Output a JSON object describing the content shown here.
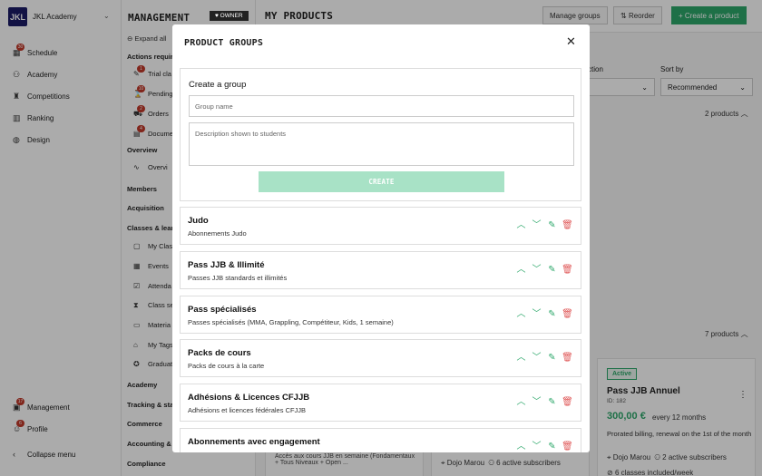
{
  "app": {
    "name": "JKL Academy",
    "logo_text": "JKL"
  },
  "rail": {
    "items": [
      {
        "label": "Schedule",
        "icon": "calendar-icon",
        "badge": "30"
      },
      {
        "label": "Academy",
        "icon": "people-icon"
      },
      {
        "label": "Competitions",
        "icon": "trophy-icon"
      },
      {
        "label": "Ranking",
        "icon": "ranking-icon"
      },
      {
        "label": "Design",
        "icon": "palette-icon"
      }
    ],
    "bottom": [
      {
        "label": "Management",
        "icon": "briefcase-icon",
        "badge": "17"
      },
      {
        "label": "Profile",
        "icon": "person-icon",
        "badge": "6"
      },
      {
        "label": "Collapse menu",
        "icon": "chevron-left-icon"
      }
    ]
  },
  "sub": {
    "title": "MANAGEMENT",
    "expand_all": "Expand all",
    "actions_header": "Actions requir",
    "actions": [
      {
        "label": "Trial cla",
        "badge": "1"
      },
      {
        "label": "Pending",
        "badge": "10"
      },
      {
        "label": "Orders",
        "badge": "2"
      },
      {
        "label": "Docume",
        "badge": "4"
      }
    ],
    "overview_header": "Overview",
    "overview_item": "Overvi",
    "members": "Members",
    "acquisition": "Acquisition",
    "classes_header": "Classes & learn",
    "classes": [
      "My Clas",
      "Events",
      "Attenda",
      "Class se",
      "Materia",
      "My Tags",
      "Graduat"
    ],
    "more": [
      "Academy",
      "Tracking & sta",
      "Commerce",
      "Accounting & i",
      "Compliance"
    ]
  },
  "main": {
    "owner_badge": "OWNER",
    "title": "MY PRODUCTS",
    "buttons": {
      "manage": "Manage groups",
      "reorder": "Reorder",
      "create": "Create a product"
    },
    "filters": {
      "section_label": "ction",
      "sort_label": "Sort by",
      "sort_value": "Recommended"
    },
    "counts": [
      "2 products",
      "7 products"
    ],
    "card": {
      "badge": "Active",
      "name": "Pass JJB Annuel",
      "id": "ID: 182",
      "price": "300,00 €",
      "period": "every 12 months",
      "billing": "Prorated billing, renewal on the 1st of the month",
      "location": "Dojo Marou",
      "subscribers": "2 active subscribers",
      "classes": "6 classes included/week"
    },
    "card2": {
      "location": "Dojo Marou",
      "subscribers": "6 active subscribers"
    },
    "card3": {
      "desc": "Accès aux cours JJB en semaine (Fondamentaux + Tous Niveaux + Open ..."
    }
  },
  "modal": {
    "title": "PRODUCT GROUPS",
    "create": {
      "title": "Create a group",
      "name_placeholder": "Group name",
      "desc_placeholder": "Description shown to students",
      "button": "CREATE"
    },
    "groups": [
      {
        "name": "Judo",
        "desc": "Abonnements Judo"
      },
      {
        "name": "Pass JJB & Illimité",
        "desc": "Passes JJB standards et illimités"
      },
      {
        "name": "Pass spécialisés",
        "desc": "Passes spécialisés (MMA, Grappling, Compétiteur, Kids, 1 semaine)"
      },
      {
        "name": "Packs de cours",
        "desc": "Packs de cours à la carte"
      },
      {
        "name": "Adhésions & Licences CFJJB",
        "desc": "Adhésions et licences fédérales CFJJB"
      },
      {
        "name": "Abonnements avec engagement",
        "desc": ""
      }
    ]
  },
  "colors": {
    "accent": "#2ea86b",
    "danger": "#e05a5a",
    "brand": "#1b1b66",
    "badge": "#c0392b"
  }
}
